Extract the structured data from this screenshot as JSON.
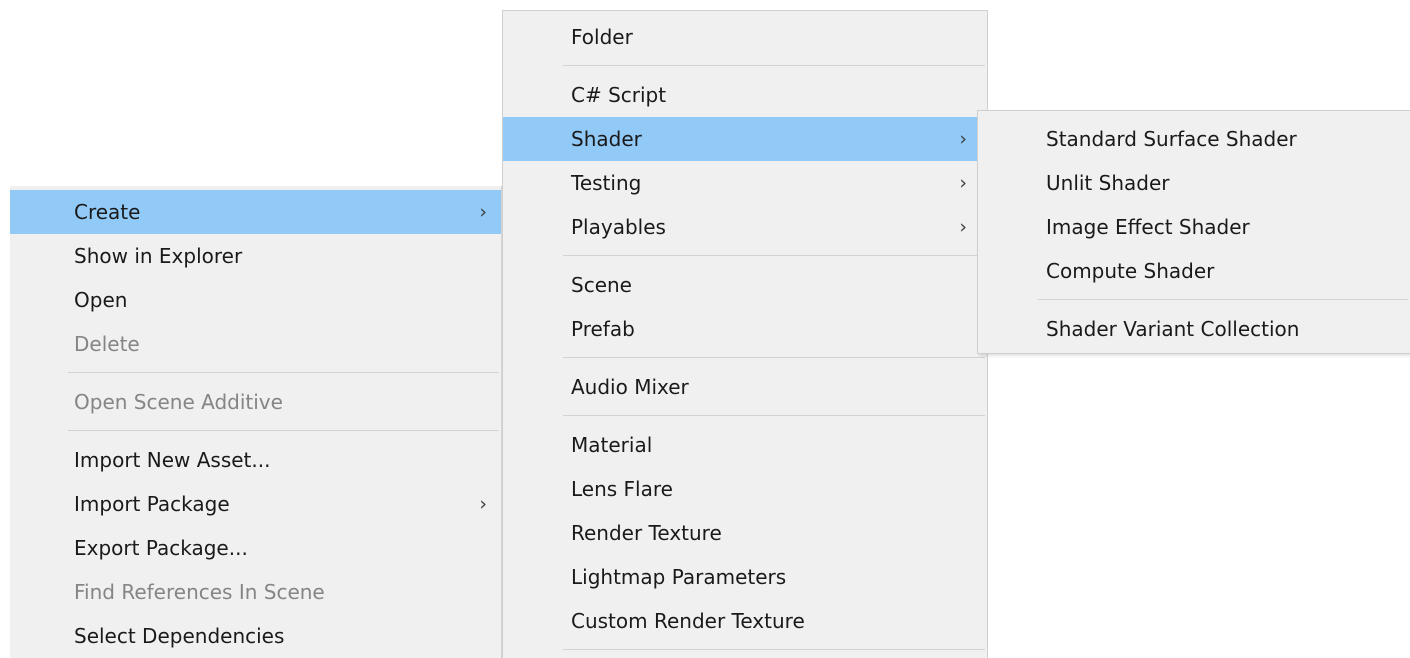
{
  "context_menu": {
    "items": [
      {
        "label": "Create",
        "arrow": "›",
        "highlight": true
      },
      {
        "label": "Show in Explorer"
      },
      {
        "label": "Open"
      },
      {
        "label": "Delete",
        "disabled": true
      },
      {
        "separator": true
      },
      {
        "label": "Open Scene Additive",
        "disabled": true
      },
      {
        "separator": true
      },
      {
        "label": "Import New Asset..."
      },
      {
        "label": "Import Package",
        "arrow": "›"
      },
      {
        "label": "Export Package..."
      },
      {
        "label": "Find References In Scene",
        "disabled": true
      },
      {
        "label": "Select Dependencies"
      }
    ]
  },
  "create_menu": {
    "items": [
      {
        "label": "Folder"
      },
      {
        "separator": true
      },
      {
        "label": "C# Script"
      },
      {
        "label": "Shader",
        "arrow": "›",
        "highlight": true
      },
      {
        "label": "Testing",
        "arrow": "›"
      },
      {
        "label": "Playables",
        "arrow": "›"
      },
      {
        "separator": true
      },
      {
        "label": "Scene"
      },
      {
        "label": "Prefab"
      },
      {
        "separator": true
      },
      {
        "label": "Audio Mixer"
      },
      {
        "separator": true
      },
      {
        "label": "Material"
      },
      {
        "label": "Lens Flare"
      },
      {
        "label": "Render Texture"
      },
      {
        "label": "Lightmap Parameters"
      },
      {
        "label": "Custom Render Texture"
      },
      {
        "separator": true
      }
    ]
  },
  "shader_menu": {
    "items": [
      {
        "label": "Standard Surface Shader"
      },
      {
        "label": "Unlit Shader"
      },
      {
        "label": "Image Effect Shader"
      },
      {
        "label": "Compute Shader"
      },
      {
        "separator": true
      },
      {
        "label": "Shader Variant Collection"
      }
    ]
  },
  "colors": {
    "menu_background": "#f0f0f0",
    "highlight": "#91c9f7",
    "disabled_text": "#858585",
    "separator": "#d3d3d3"
  }
}
